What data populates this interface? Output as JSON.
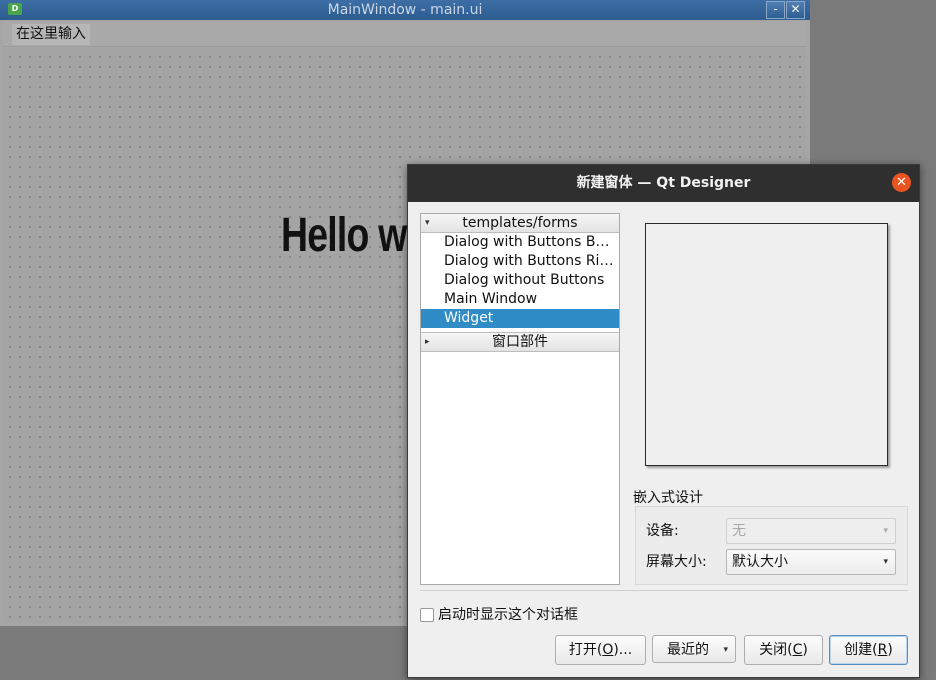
{
  "background_window": {
    "title": "MainWindow - main.ui",
    "app_icon": "D",
    "minimize_glyph": "-",
    "close_glyph": "✕",
    "menu_placeholder": "在这里输入",
    "canvas_label": "Hello w"
  },
  "dialog": {
    "title": "新建窗体 — Qt Designer",
    "close_glyph": "✕",
    "tree": {
      "group1": "templates/forms",
      "items": [
        "Dialog with Buttons Bottom",
        "Dialog with Buttons Right",
        "Dialog without Buttons",
        "Main Window",
        "Widget"
      ],
      "selected": "Widget",
      "group2": "窗口部件"
    },
    "embedded_design": {
      "label": "嵌入式设计",
      "device_label": "设备:",
      "device_value": "无",
      "screen_size_label": "屏幕大小:",
      "screen_size_value": "默认大小"
    },
    "show_on_startup": "启动时显示这个对话框",
    "buttons": {
      "open_pre": "打开(",
      "open_key": "O",
      "open_post": ")...",
      "recent": "最近的",
      "close_pre": "关闭(",
      "close_key": "C",
      "close_post": ")",
      "create_pre": "创建(",
      "create_key": "R",
      "create_post": ")"
    }
  },
  "icons": {
    "expanded": "▾",
    "collapsed": "▸",
    "dropdown": "▾"
  }
}
